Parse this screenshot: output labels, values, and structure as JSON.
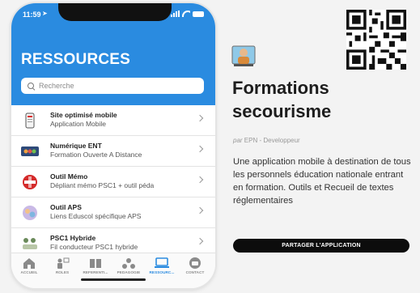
{
  "status_bar": {
    "time": "11:59",
    "location_icon": "location-arrow-icon",
    "icons": [
      "signal-icon",
      "wifi-icon",
      "battery-icon"
    ]
  },
  "screen": {
    "title": "RESSOURCES",
    "search": {
      "placeholder": "Recherche"
    },
    "items": [
      {
        "title": "Site optimisé mobile",
        "subtitle": "Application Mobile",
        "icon": "mobile-site-icon"
      },
      {
        "title": "Numérique ENT",
        "subtitle": "Formation Ouverte A Distance",
        "icon": "ent-icon"
      },
      {
        "title": "Outil Mémo",
        "subtitle": "Dépliant mémo PSC1 + outil péda",
        "icon": "psc1-memo-icon"
      },
      {
        "title": "Outil APS",
        "subtitle": "Liens Eduscol spécifique APS",
        "icon": "aps-icon"
      },
      {
        "title": "PSC1 Hybride",
        "subtitle": "Fil conducteur PSC1 hybride",
        "icon": "psc1-hybrid-icon"
      }
    ],
    "tabs": [
      {
        "label": "ACCUEIL",
        "icon": "home-icon"
      },
      {
        "label": "ROLES",
        "icon": "roles-icon"
      },
      {
        "label": "REFERENTI...",
        "icon": "book-icon"
      },
      {
        "label": "PEDAGOGIE",
        "icon": "pedagogy-icon"
      },
      {
        "label": "RESSOURC...",
        "icon": "resources-icon",
        "active": true
      },
      {
        "label": "CONTACT",
        "icon": "contact-icon"
      }
    ]
  },
  "app_info": {
    "title_line1": "Formations",
    "title_line2": "secourisme",
    "by_prefix": "par",
    "developer": "EPN - Developpeur",
    "description": "Une application mobile à destination de tous les personnels éducation nationale entrant en formation. Outils et Recueil de textes réglementaires",
    "share_label": "PARTAGER L'APPLICATION",
    "qr_icon": "qr-code-icon",
    "logo_icon": "app-logo-icon"
  },
  "colors": {
    "accent": "#2a8be0",
    "share_bg": "#0c0c0c"
  }
}
